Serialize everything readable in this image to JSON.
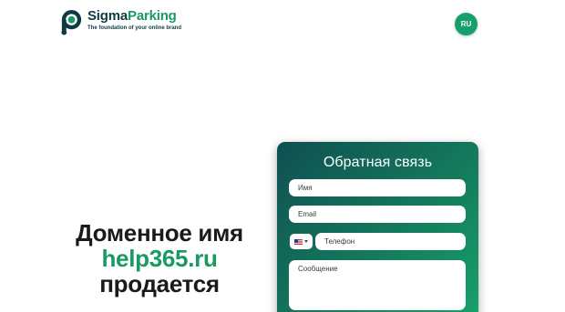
{
  "brand": {
    "name_part1": "Sigma",
    "name_part2": "Parking",
    "tagline": "The foundation of your online brand",
    "colors": {
      "dark": "#0d3b40",
      "accent": "#1a9a63"
    }
  },
  "header": {
    "language_button": "RU"
  },
  "headline": {
    "line1": "Доменное имя",
    "domain": "help365.ru",
    "line3": "продается"
  },
  "contact_form": {
    "title": "Обратная связь",
    "name_placeholder": "Имя",
    "email_placeholder": "Email",
    "phone_country_icon": "us-flag-icon",
    "phone_placeholder": "Телефон",
    "message_placeholder": "Сообщение",
    "gradient_colors": [
      "#0f4f52",
      "#147a5c",
      "#18a36b"
    ]
  }
}
